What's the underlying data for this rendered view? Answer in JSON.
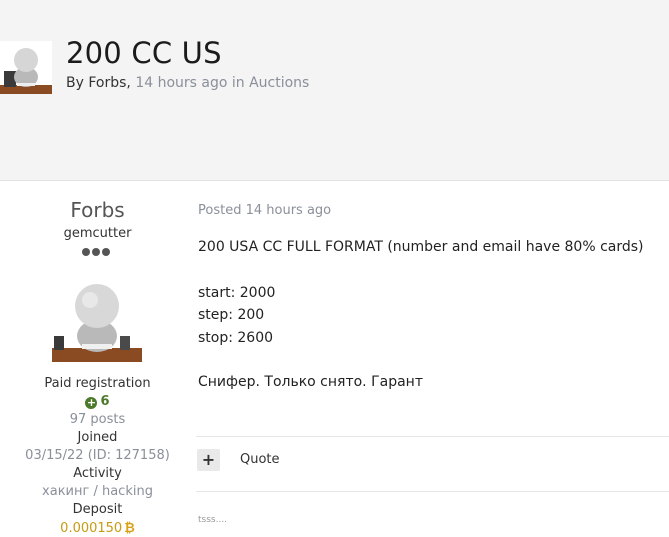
{
  "topic": {
    "title": "200 CC US",
    "by_prefix": "By",
    "author": "Forbs",
    "separator": ",",
    "time": "14 hours ago",
    "in_prefix": "in",
    "forum": "Auctions"
  },
  "author_panel": {
    "name": "Forbs",
    "rank": "gemcutter",
    "group": "Paid registration",
    "reputation": "6",
    "posts": "97 posts",
    "joined_label": "Joined",
    "joined_value": "03/15/22 (ID: 127158)",
    "activity_label": "Activity",
    "activity_value": "хакинг / hacking",
    "deposit_label": "Deposit",
    "deposit_value": "0.000150",
    "deposit_icon": "bitcoin-icon",
    "reputation_icon": "plus-circle-icon"
  },
  "post": {
    "posted": "Posted 14 hours ago",
    "lines": [
      "200 USA CC FULL FORMAT (number and email have 80% cards)",
      "start: 2000",
      "step: 200",
      "stop: 2600",
      "Снифер. Только снято. Гарант"
    ],
    "plus_label": "+",
    "quote_label": "Quote",
    "signature": "tsss...."
  },
  "colors": {
    "header_bg": "#f4f4f4",
    "muted_text": "#8a8f99",
    "reputation_green": "#4b7a2a",
    "deposit_gold": "#c79a12"
  }
}
